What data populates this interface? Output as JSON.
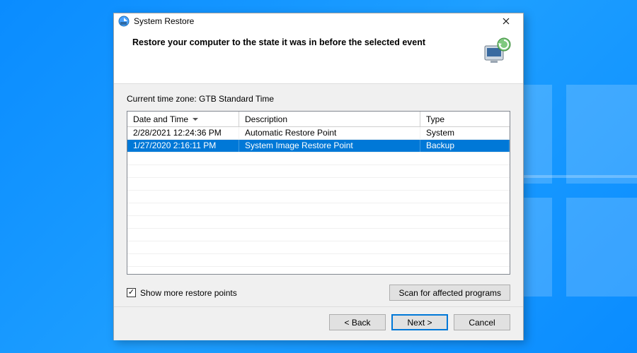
{
  "window": {
    "title": "System Restore",
    "heading": "Restore your computer to the state it was in before the selected event"
  },
  "timezone_label": "Current time zone: GTB Standard Time",
  "table": {
    "columns": {
      "date": "Date and Time",
      "description": "Description",
      "type": "Type"
    },
    "rows": [
      {
        "date": "2/28/2021 12:24:36 PM",
        "description": "Automatic Restore Point",
        "type": "System",
        "selected": false
      },
      {
        "date": "1/27/2020 2:16:11 PM",
        "description": "System Image Restore Point",
        "type": "Backup",
        "selected": true
      }
    ]
  },
  "show_more": {
    "label": "Show more restore points",
    "checked": true
  },
  "buttons": {
    "scan": "Scan for affected programs",
    "back": "< Back",
    "next": "Next >",
    "cancel": "Cancel"
  }
}
